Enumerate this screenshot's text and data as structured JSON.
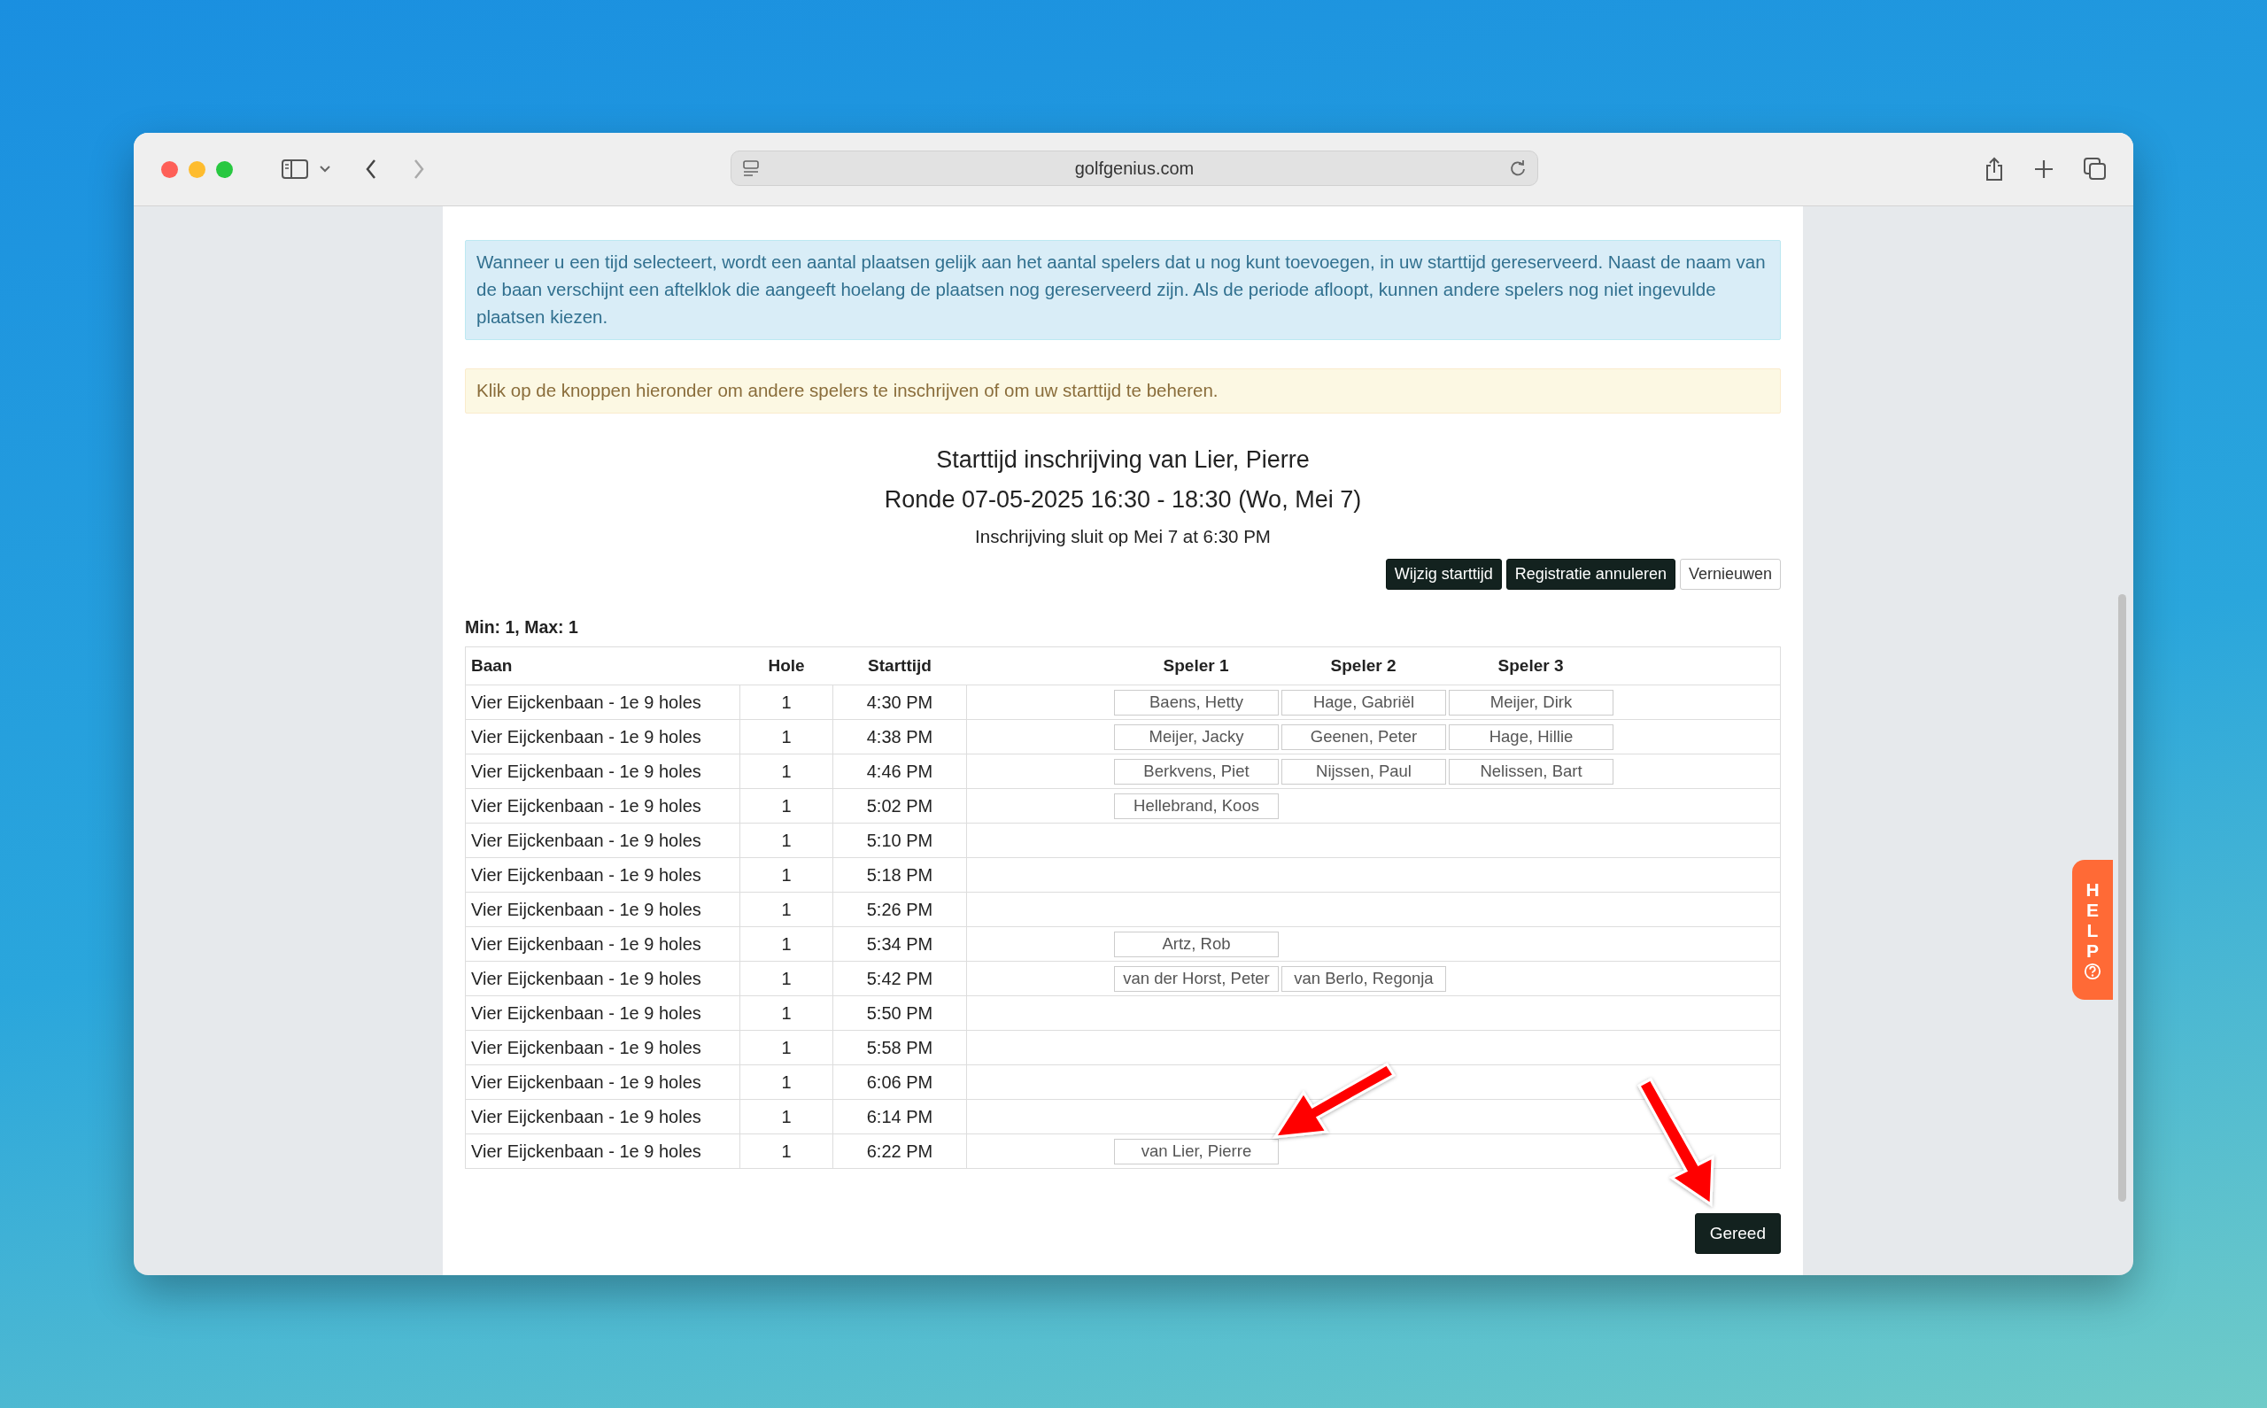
{
  "browser": {
    "url": "golfgenius.com"
  },
  "info_message": "Wanneer u een tijd selecteert, wordt een aantal plaatsen gelijk aan het aantal spelers dat u nog kunt toevoegen, in uw starttijd gereserveerd. Naast de naam van de baan verschijnt een aftelklok die aangeeft hoelang de plaatsen nog gereserveerd zijn. Als de periode afloopt, kunnen andere spelers nog niet ingevulde plaatsen kiezen.",
  "notice_message": "Klik op de knoppen hieronder om andere spelers te inschrijven of om uw starttijd te beheren.",
  "title": "Starttijd inschrijving van Lier, Pierre",
  "round": "Ronde 07-05-2025 16:30 - 18:30 (Wo, Mei 7)",
  "closing": "Inschrijving sluit op Mei 7 at 6:30 PM",
  "actions": [
    {
      "label": "Wijzig starttijd",
      "kind": "primary"
    },
    {
      "label": "Registratie annuleren",
      "kind": "primary"
    },
    {
      "label": "Vernieuwen",
      "kind": "secondary"
    }
  ],
  "limits": "Min: 1, Max: 1",
  "table": {
    "columns": [
      "Baan",
      "Hole",
      "Starttijd",
      "Speler 1",
      "Speler 2",
      "Speler 3"
    ],
    "rows": [
      {
        "course": "Vier Eijckenbaan - 1e 9 holes",
        "hole": "1",
        "time": "4:30 PM",
        "players": [
          "Baens, Hetty",
          "Hage, Gabriël",
          "Meijer, Dirk"
        ]
      },
      {
        "course": "Vier Eijckenbaan - 1e 9 holes",
        "hole": "1",
        "time": "4:38 PM",
        "players": [
          "Meijer, Jacky",
          "Geenen, Peter",
          "Hage, Hillie"
        ]
      },
      {
        "course": "Vier Eijckenbaan - 1e 9 holes",
        "hole": "1",
        "time": "4:46 PM",
        "players": [
          "Berkvens, Piet",
          "Nijssen, Paul",
          "Nelissen, Bart"
        ]
      },
      {
        "course": "Vier Eijckenbaan - 1e 9 holes",
        "hole": "1",
        "time": "5:02 PM",
        "players": [
          "Hellebrand, Koos"
        ]
      },
      {
        "course": "Vier Eijckenbaan - 1e 9 holes",
        "hole": "1",
        "time": "5:10 PM",
        "players": []
      },
      {
        "course": "Vier Eijckenbaan - 1e 9 holes",
        "hole": "1",
        "time": "5:18 PM",
        "players": []
      },
      {
        "course": "Vier Eijckenbaan - 1e 9 holes",
        "hole": "1",
        "time": "5:26 PM",
        "players": []
      },
      {
        "course": "Vier Eijckenbaan - 1e 9 holes",
        "hole": "1",
        "time": "5:34 PM",
        "players": [
          "Artz, Rob"
        ]
      },
      {
        "course": "Vier Eijckenbaan - 1e 9 holes",
        "hole": "1",
        "time": "5:42 PM",
        "players": [
          "van der Horst, Peter",
          "van Berlo, Regonja"
        ]
      },
      {
        "course": "Vier Eijckenbaan - 1e 9 holes",
        "hole": "1",
        "time": "5:50 PM",
        "players": []
      },
      {
        "course": "Vier Eijckenbaan - 1e 9 holes",
        "hole": "1",
        "time": "5:58 PM",
        "players": []
      },
      {
        "course": "Vier Eijckenbaan - 1e 9 holes",
        "hole": "1",
        "time": "6:06 PM",
        "players": []
      },
      {
        "course": "Vier Eijckenbaan - 1e 9 holes",
        "hole": "1",
        "time": "6:14 PM",
        "players": []
      },
      {
        "course": "Vier Eijckenbaan - 1e 9 holes",
        "hole": "1",
        "time": "6:22 PM",
        "players": [
          "van Lier, Pierre"
        ]
      }
    ]
  },
  "done_button": "Gereed",
  "help_tab": "HELP"
}
